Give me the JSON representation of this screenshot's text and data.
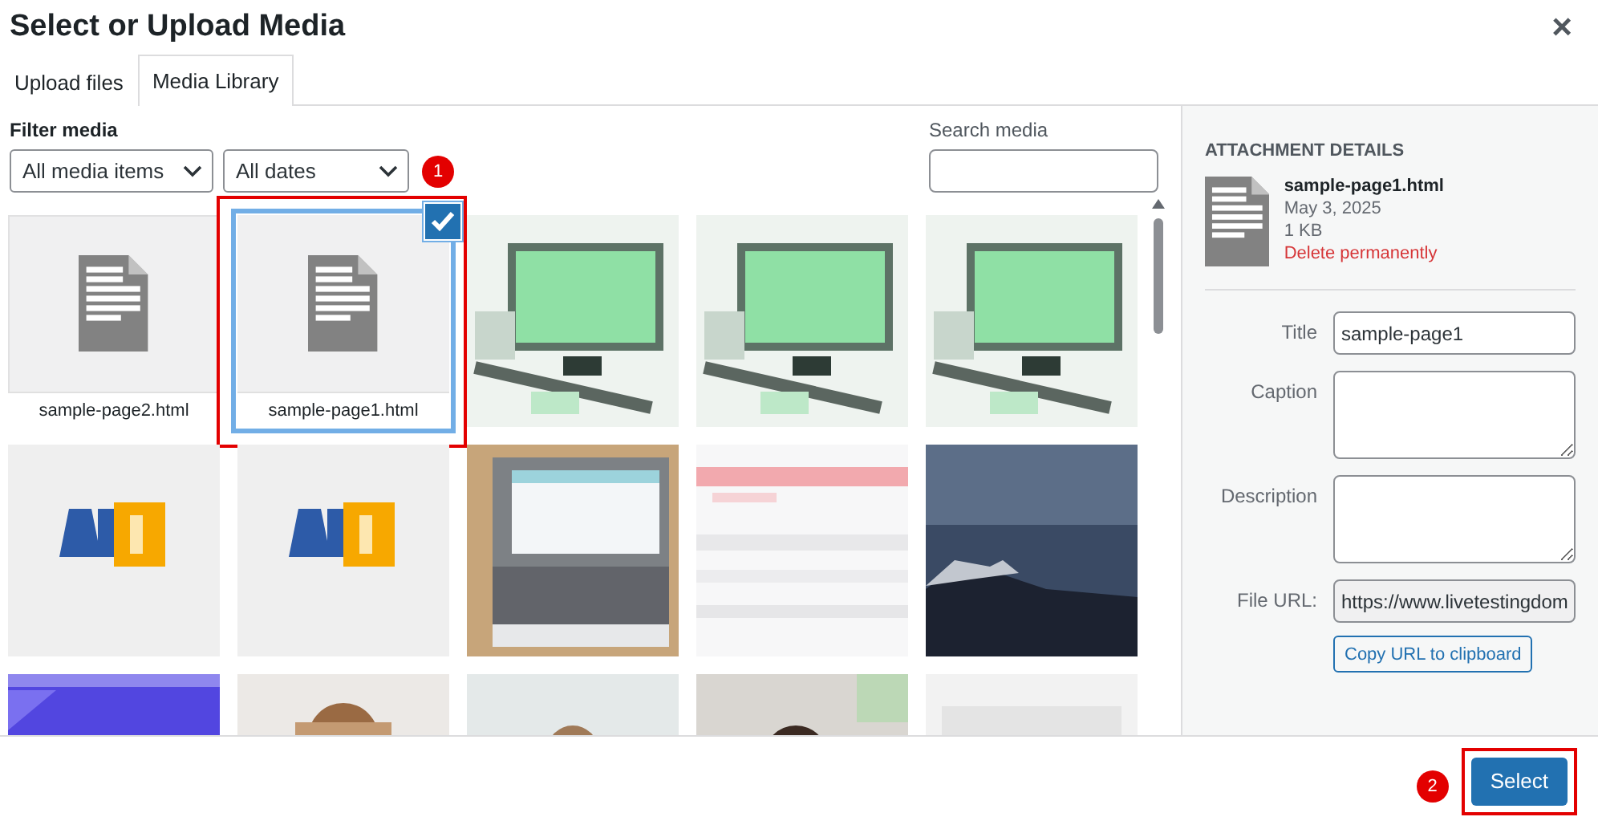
{
  "title": "Select or Upload Media",
  "close": "×",
  "tabs": [
    {
      "label": "Upload files",
      "selected": false
    },
    {
      "label": "Media Library",
      "selected": true
    }
  ],
  "filter": {
    "label": "Filter media",
    "type_select": "All media items",
    "date_select": "All dates"
  },
  "search": {
    "label": "Search media"
  },
  "items": [
    {
      "kind": "document",
      "filename": "sample-page2.html",
      "selected": false
    },
    {
      "kind": "document",
      "filename": "sample-page1.html",
      "selected": true
    },
    {
      "kind": "picture"
    },
    {
      "kind": "picture"
    },
    {
      "kind": "picture"
    },
    {
      "kind": "picture"
    },
    {
      "kind": "picture"
    },
    {
      "kind": "picture"
    },
    {
      "kind": "picture"
    },
    {
      "kind": "picture"
    },
    {
      "kind": "picture"
    },
    {
      "kind": "picture"
    },
    {
      "kind": "picture"
    },
    {
      "kind": "picture"
    },
    {
      "kind": "picture"
    }
  ],
  "details": {
    "heading": "ATTACHMENT DETAILS",
    "filename": "sample-page1.html",
    "date": "May 3, 2025",
    "size": "1 KB",
    "delete": "Delete permanently",
    "fields": [
      {
        "label": "Title",
        "value": "sample-page1",
        "kind": "text"
      },
      {
        "label": "Caption",
        "kind": "textarea"
      },
      {
        "label": "Description",
        "kind": "textarea"
      },
      {
        "label": "File URL:",
        "value": "https://www.livetestingdom",
        "kind": "readonly"
      }
    ],
    "copy_button": "Copy URL to clipboard"
  },
  "select_button": "Select",
  "annotations": [
    {
      "label": "1"
    },
    {
      "label": "2"
    }
  ]
}
